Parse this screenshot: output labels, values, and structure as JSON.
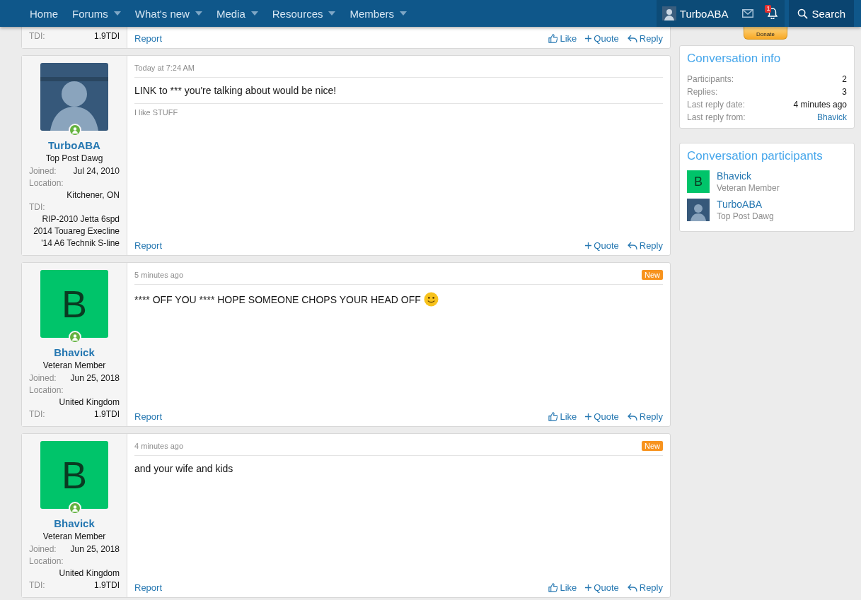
{
  "nav": {
    "items": [
      {
        "label": "Home",
        "has_menu": false,
        "selected": false
      },
      {
        "label": "Forums",
        "has_menu": true,
        "selected": false
      },
      {
        "label": "What's new",
        "has_menu": true,
        "selected": false
      },
      {
        "label": "Media",
        "has_menu": true,
        "selected": false
      },
      {
        "label": "Resources",
        "has_menu": true,
        "selected": false
      },
      {
        "label": "Members",
        "has_menu": true,
        "selected": false
      }
    ],
    "user": {
      "name": "TurboABA"
    },
    "alerts_count": "1",
    "search": "Search"
  },
  "posts": [
    {
      "partial": true,
      "user": {
        "fields": [
          {
            "label": "TDI:",
            "lines": [
              "1.9TDI"
            ]
          }
        ]
      },
      "report": "Report",
      "actions": [
        {
          "kind": "like",
          "label": "Like"
        },
        {
          "kind": "quote",
          "label": "Quote"
        },
        {
          "kind": "reply",
          "label": "Reply"
        }
      ]
    },
    {
      "partial": false,
      "date": "Today at 7:24 AM",
      "is_new": false,
      "user": {
        "online": true,
        "name": "TurboABA",
        "title": "Top Post Dawg",
        "fields": [
          {
            "label": "Joined:",
            "lines": [
              "Jul 24, 2010"
            ]
          },
          {
            "label": "Location:",
            "lines": [
              "Kitchener, ON"
            ]
          },
          {
            "label": "TDI:",
            "lines": [
              "RIP-2010 Jetta 6spd",
              "2014 Touareg Execline",
              "'14 A6 Technik S-line"
            ]
          }
        ]
      },
      "message": "LINK to *** you're talking about would be nice!",
      "smiley": false,
      "signature": "I like STUFF",
      "report": "Report",
      "actions": [
        {
          "kind": "quote",
          "label": "Quote"
        },
        {
          "kind": "reply",
          "label": "Reply"
        }
      ]
    },
    {
      "partial": false,
      "date": "5 minutes ago",
      "is_new": true,
      "new_label": "New",
      "user": {
        "avatar": {
          "kind": "letter",
          "letter": "B",
          "color": "#00c46a"
        },
        "online": true,
        "name": "Bhavick",
        "title": "Veteran Member",
        "fields": [
          {
            "label": "Joined:",
            "lines": [
              "Jun 25, 2018"
            ]
          },
          {
            "label": "Location:",
            "lines": [
              "United Kingdom"
            ]
          },
          {
            "label": "TDI:",
            "lines": [
              "1.9TDI"
            ]
          }
        ]
      },
      "message": "**** OFF YOU **** HOPE SOMEONE CHOPS YOUR HEAD OFF",
      "smiley": true,
      "report": "Report",
      "actions": [
        {
          "kind": "like",
          "label": "Like"
        },
        {
          "kind": "quote",
          "label": "Quote"
        },
        {
          "kind": "reply",
          "label": "Reply"
        }
      ]
    },
    {
      "partial": false,
      "date": "4 minutes ago",
      "is_new": true,
      "new_label": "New",
      "user": {
        "avatar": {
          "kind": "letter",
          "letter": "B",
          "color": "#00c46a"
        },
        "online": true,
        "name": "Bhavick",
        "title": "Veteran Member",
        "fields": [
          {
            "label": "Joined:",
            "lines": [
              "Jun 25, 2018"
            ]
          },
          {
            "label": "Location:",
            "lines": [
              "United Kingdom"
            ]
          },
          {
            "label": "TDI:",
            "lines": [
              "1.9TDI"
            ]
          }
        ]
      },
      "message": "and your wife and kids",
      "smiley": false,
      "report": "Report",
      "actions": [
        {
          "kind": "like",
          "label": "Like"
        },
        {
          "kind": "quote",
          "label": "Quote"
        },
        {
          "kind": "reply",
          "label": "Reply"
        }
      ]
    }
  ],
  "sidebar": {
    "donate": "Donate",
    "info": {
      "title": "Conversation info",
      "rows": [
        {
          "label": "Participants:",
          "value": "2",
          "link": false
        },
        {
          "label": "Replies:",
          "value": "3",
          "link": false
        },
        {
          "label": "Last reply date:",
          "value": "4 minutes ago",
          "link": false
        },
        {
          "label": "Last reply from:",
          "value": "Bhavick",
          "link": true
        }
      ]
    },
    "participants": {
      "title": "Conversation participants",
      "items": [
        {
          "name": "Bhavick",
          "title": "Veteran Member",
          "avatar": {
            "kind": "letter",
            "letter": "B",
            "color": "#00c46a"
          }
        },
        {
          "name": "TurboABA",
          "title": "Top Post Dawg"
        }
      ]
    }
  }
}
